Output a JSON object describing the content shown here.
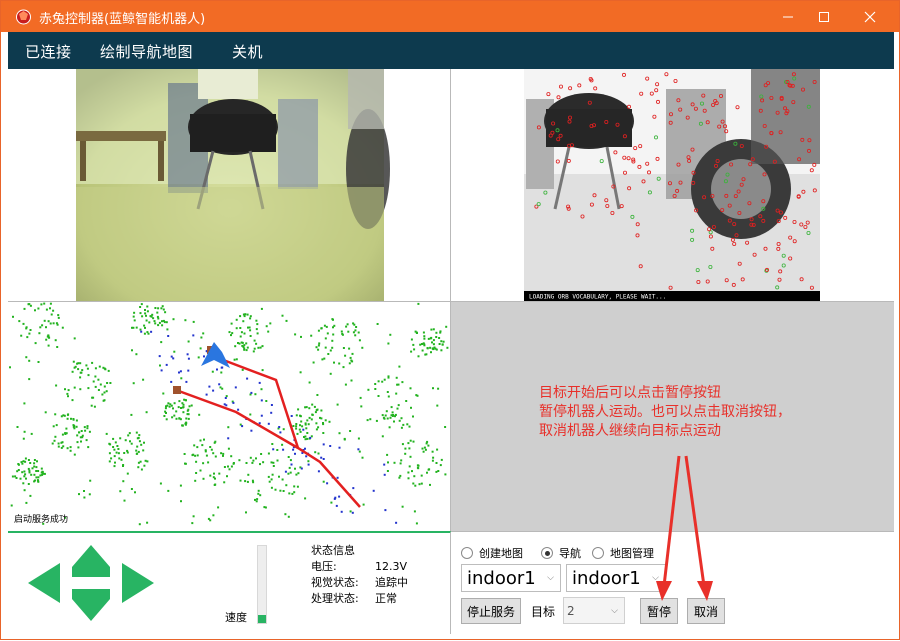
{
  "window": {
    "title": "赤兔控制器(蓝鲸智能机器人)",
    "accent_color": "#f26b25",
    "menu_bg": "#0d3a4e",
    "controls": [
      "minimize-icon",
      "maximize-icon",
      "close-icon"
    ]
  },
  "menu": {
    "items": [
      "已连接",
      "绘制导航地图",
      "关机"
    ]
  },
  "camera": {
    "orb_overlay_text": "LOADING ORB VOCABULARY, PLEASE WAIT..."
  },
  "map": {
    "status_text": "启动服务成功",
    "obstacle_color": "#22b21f",
    "path_color": "#e32020",
    "scan_color": "#2233cc"
  },
  "annotation": {
    "color": "#e8302a",
    "lines": [
      "目标开始后可以点击暂停按钮",
      "暂停机器人运动。也可以点击取消按钮，",
      "取消机器人继续向目标点运动"
    ]
  },
  "joystick": {
    "color": "#28b463",
    "buttons": [
      "up-arrow",
      "down-arrow",
      "left-arrow",
      "right-arrow"
    ]
  },
  "speed": {
    "label": "速度",
    "level": 0.1
  },
  "status": {
    "header": "状态信息",
    "rows": [
      {
        "key": "电压:",
        "value": "12.3V"
      },
      {
        "key": "视觉状态:",
        "value": "追踪中"
      },
      {
        "key": "处理状态:",
        "value": "正常"
      }
    ]
  },
  "mode": {
    "options": [
      {
        "label": "创建地图",
        "checked": false
      },
      {
        "label": "导航",
        "checked": true
      },
      {
        "label": "地图管理",
        "checked": false
      }
    ]
  },
  "maps": {
    "combo1_value": "indoor1",
    "combo2_value": "indoor1"
  },
  "nav_controls": {
    "stop_service_label": "停止服务",
    "target_label": "目标",
    "target_value": "2",
    "pause_label": "暂停",
    "cancel_label": "取消"
  }
}
